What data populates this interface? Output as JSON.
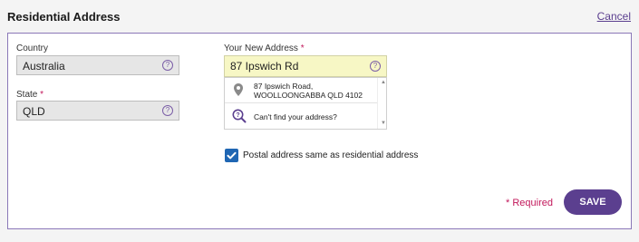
{
  "header": {
    "title": "Residential Address",
    "cancel_label": "Cancel"
  },
  "form": {
    "country": {
      "label": "Country",
      "value": "Australia"
    },
    "state": {
      "label": "State",
      "required_mark": "*",
      "value": "QLD"
    },
    "new_address": {
      "label": "Your New Address",
      "required_mark": "*",
      "value": "87 Ipswich Rd"
    },
    "suggestions": [
      {
        "icon": "location-pin-icon",
        "line1": "87 Ipswich Road,",
        "line2": "WOOLLOONGABBA QLD 4102"
      },
      {
        "icon": "magnifier-question-icon",
        "text": "Can't find your address?"
      }
    ],
    "postal_same": {
      "checked": true,
      "label": "Postal address same as residential address"
    },
    "required_note": "* Required",
    "save_label": "SAVE"
  },
  "colors": {
    "accent": "#5b3f8f",
    "required": "#c2185b",
    "checkbox": "#1f66b3",
    "address_highlight": "#f7f7c5"
  }
}
